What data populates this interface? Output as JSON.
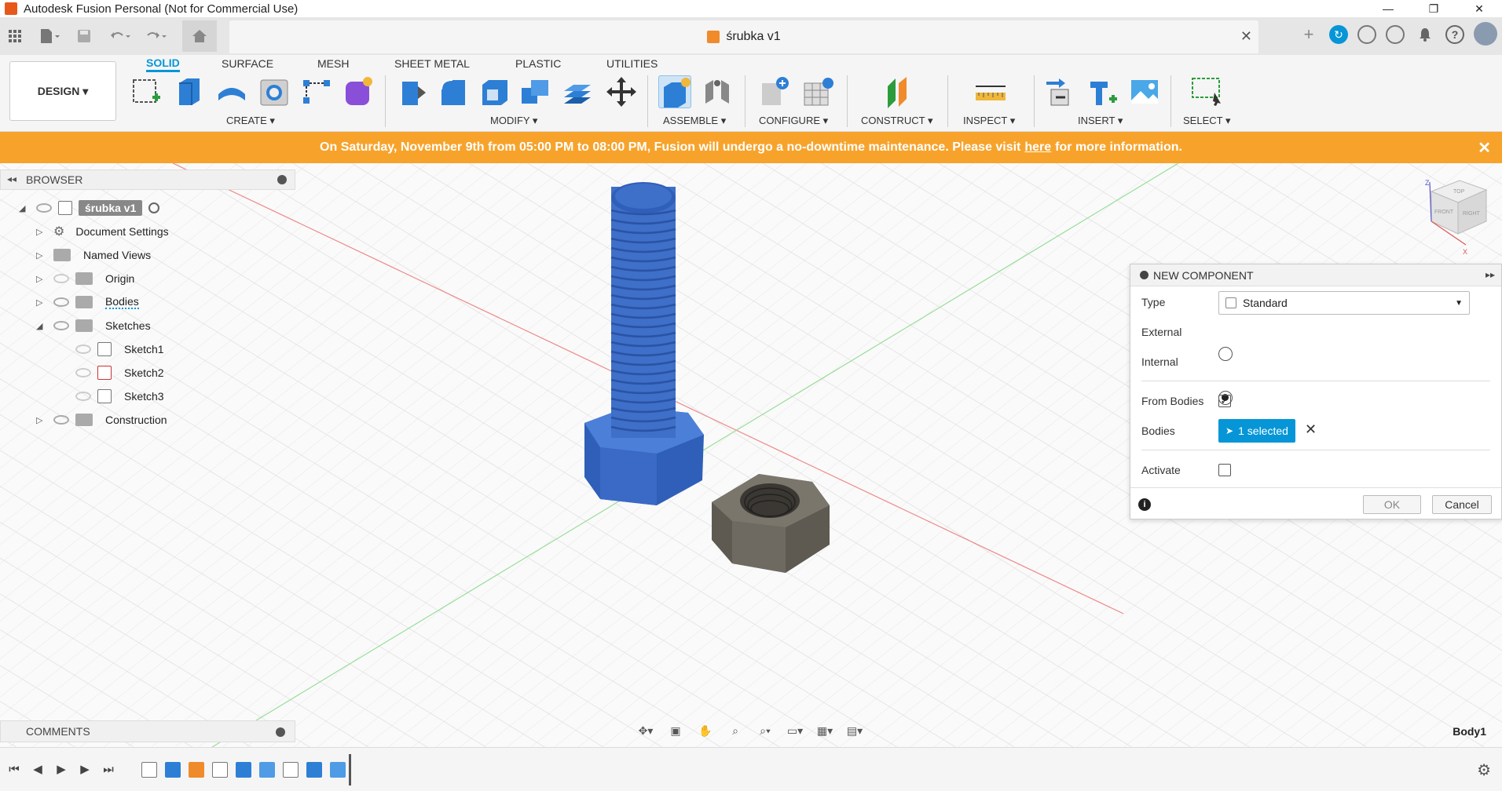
{
  "window": {
    "title": "Autodesk Fusion Personal (Not for Commercial Use)",
    "controls": [
      "—",
      "❐",
      "✕"
    ]
  },
  "document": {
    "tab_title": "śrubka v1",
    "close_glyph": "✕"
  },
  "design_button": "DESIGN ▾",
  "workspace_tabs": [
    "SOLID",
    "SURFACE",
    "MESH",
    "SHEET METAL",
    "PLASTIC",
    "UTILITIES"
  ],
  "toolbar_groups": [
    "CREATE ▾",
    "MODIFY ▾",
    "ASSEMBLE ▾",
    "CONFIGURE ▾",
    "CONSTRUCT ▾",
    "INSPECT ▾",
    "INSERT ▾",
    "SELECT ▾"
  ],
  "banner": {
    "text_before": "On Saturday, November 9th from 05:00 PM to 08:00 PM, Fusion will undergo a no-downtime maintenance. Please visit",
    "link": "here",
    "text_after": "for more information.",
    "close_glyph": "✕",
    "color": "#f7a32b"
  },
  "browser": {
    "header": "BROWSER",
    "root": "śrubka v1",
    "items": [
      "Document Settings",
      "Named Views",
      "Origin",
      "Bodies",
      "Sketches",
      "Sketch1",
      "Sketch2",
      "Sketch3",
      "Construction"
    ]
  },
  "comments": {
    "header": "COMMENTS"
  },
  "new_component": {
    "header": "NEW COMPONENT",
    "type_label": "Type",
    "type_value": "Standard",
    "external_label": "External",
    "internal_label": "Internal",
    "from_bodies_label": "From Bodies",
    "from_bodies_check": "✓",
    "bodies_label": "Bodies",
    "bodies_value": "1 selected",
    "bodies_clear": "✕",
    "activate_label": "Activate",
    "ok": "OK",
    "cancel": "Cancel",
    "info": "i"
  },
  "viewcube": {
    "top": "TOP",
    "front": "FRONT",
    "right": "RIGHT",
    "axis_z": "Z",
    "axis_x": "X"
  },
  "status_label": "Body1",
  "colors": {
    "accent": "#0696d7",
    "bolt": "#3e6fc9",
    "nut": "#6e6a62",
    "banner": "#f7a32b"
  }
}
